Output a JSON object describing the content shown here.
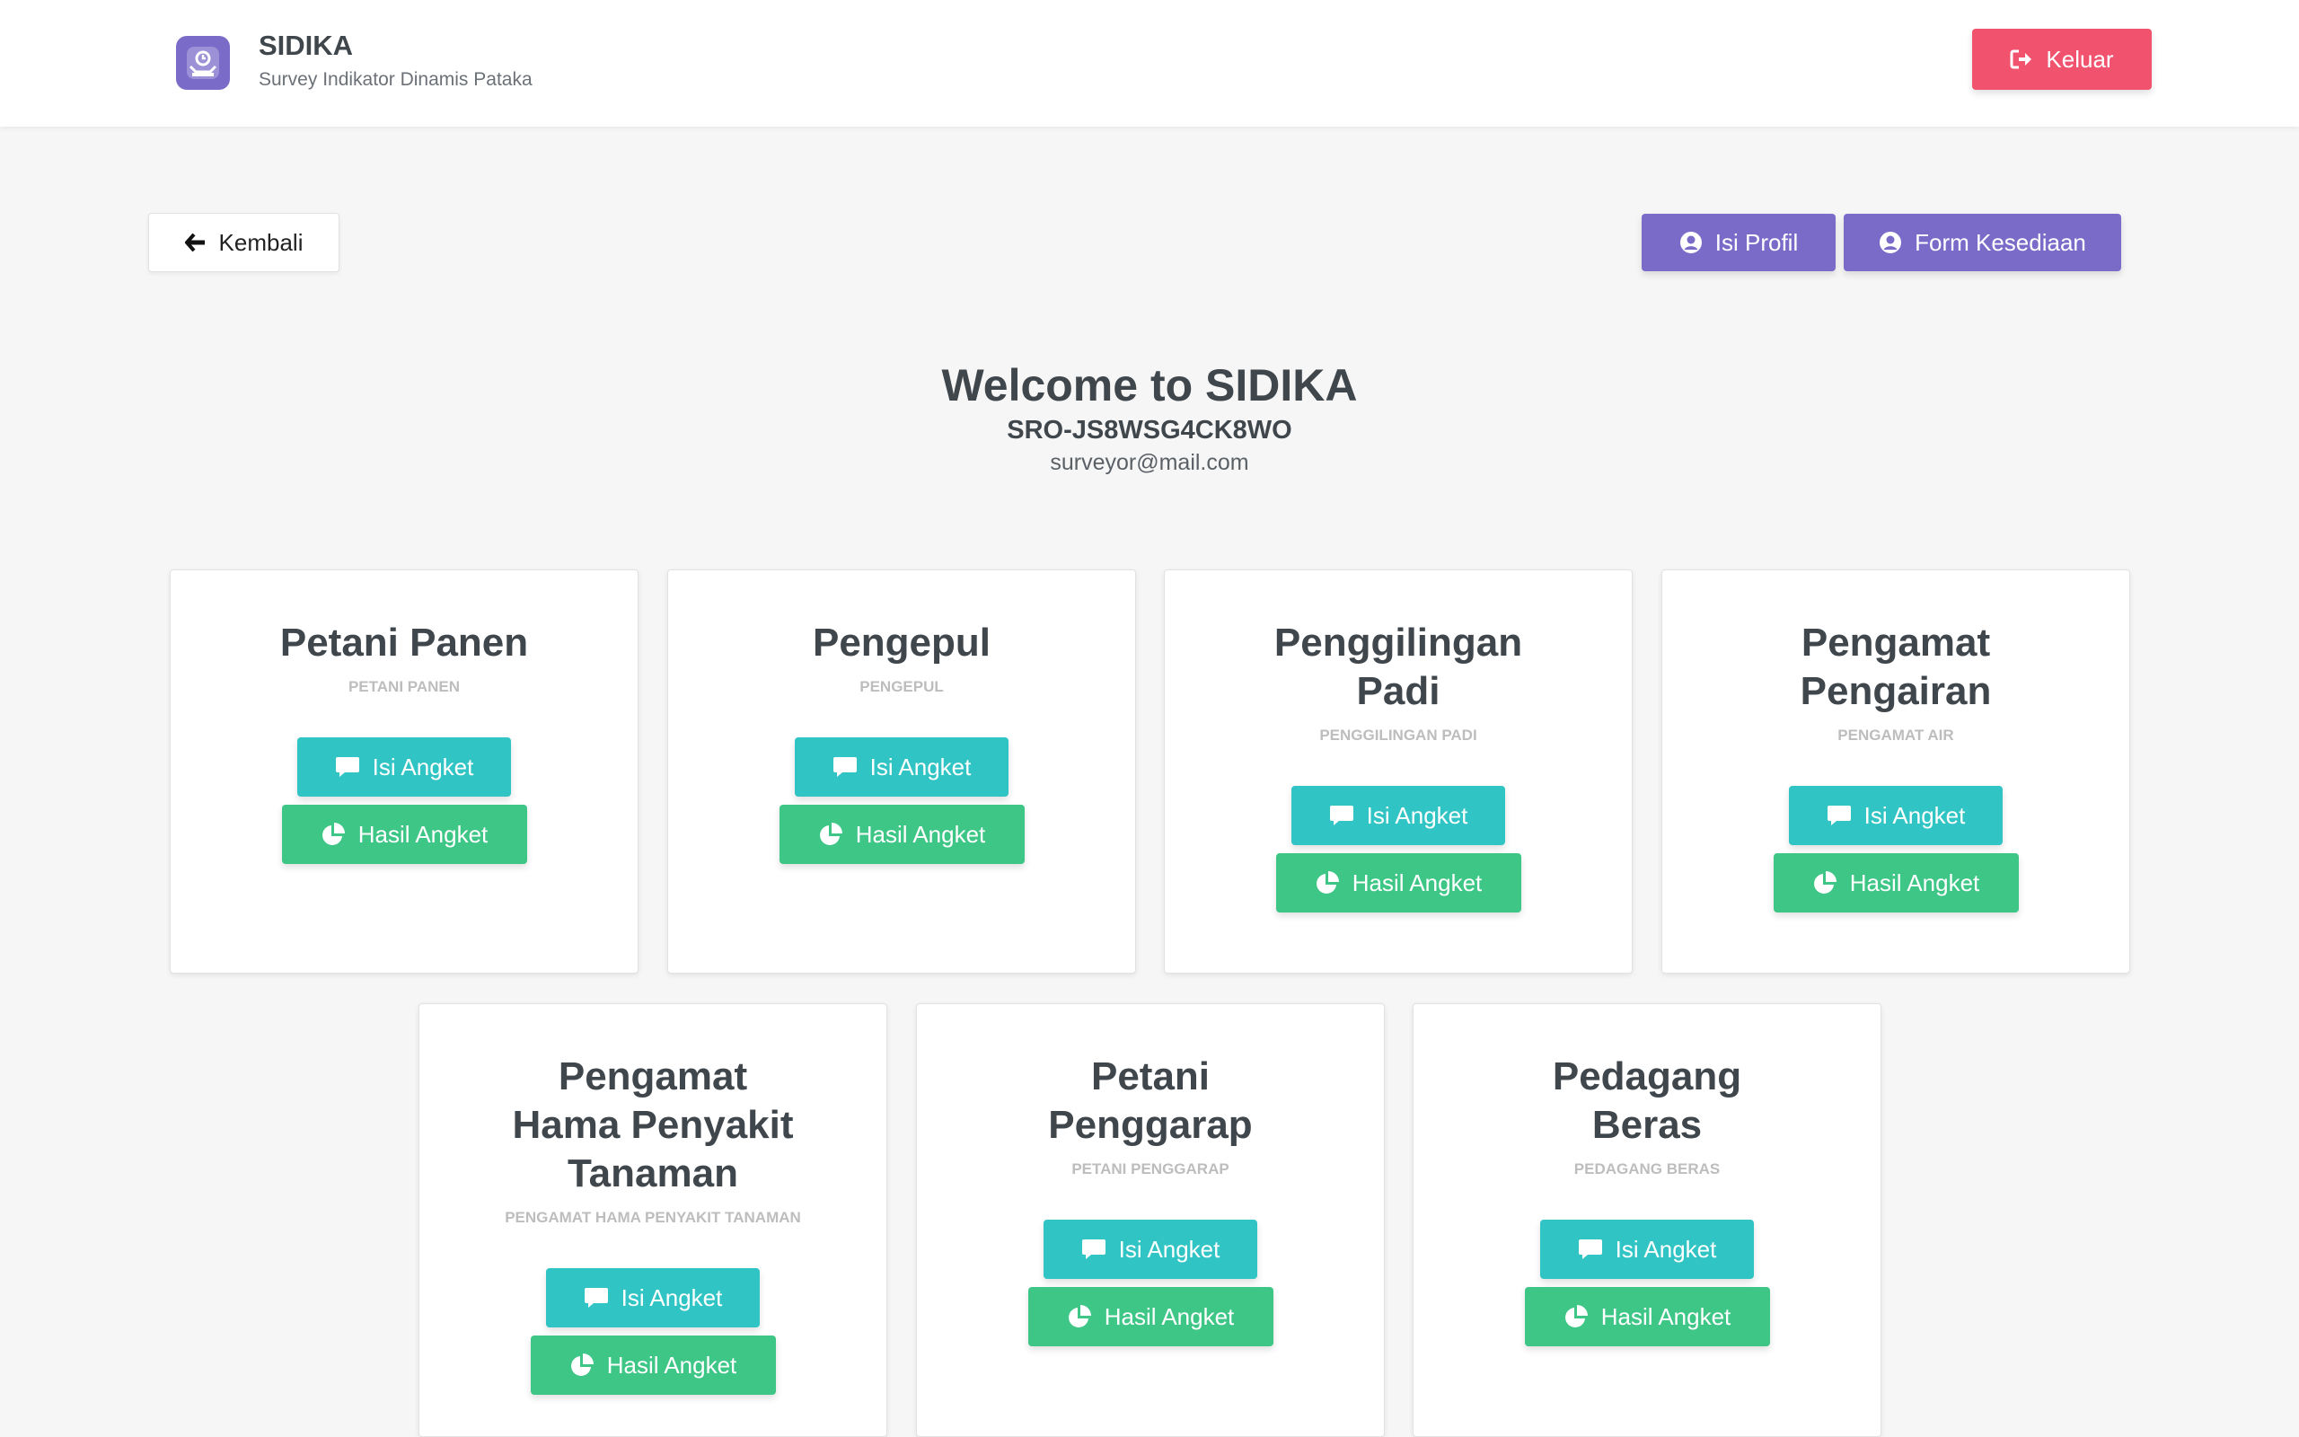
{
  "header": {
    "app_title": "SIDIKA",
    "app_subtitle": "Survey Indikator Dinamis Pataka",
    "logout_label": "Keluar"
  },
  "toolbar": {
    "back_label": "Kembali",
    "profile_label": "Isi Profil",
    "kesediaan_label": "Form Kesediaan"
  },
  "welcome": {
    "title": "Welcome to SIDIKA",
    "code": "SRO-JS8WSG4CK8WO",
    "email": "surveyor@mail.com"
  },
  "cards": [
    {
      "title": "Petani Panen",
      "subtitle": "PETANI PANEN",
      "isi_label": "Isi Angket",
      "hasil_label": "Hasil Angket"
    },
    {
      "title": "Pengepul",
      "subtitle": "PENGEPUL",
      "isi_label": "Isi Angket",
      "hasil_label": "Hasil Angket"
    },
    {
      "title": "Penggilingan Padi",
      "subtitle": "PENGGILINGAN PADI",
      "isi_label": "Isi Angket",
      "hasil_label": "Hasil Angket"
    },
    {
      "title": "Pengamat Pengairan",
      "subtitle": "PENGAMAT AIR",
      "isi_label": "Isi Angket",
      "hasil_label": "Hasil Angket"
    },
    {
      "title": "Pengamat Hama Penyakit Tanaman",
      "subtitle": "PENGAMAT HAMA PENYAKIT TANAMAN",
      "isi_label": "Isi Angket",
      "hasil_label": "Hasil Angket"
    },
    {
      "title": "Petani Penggarap",
      "subtitle": "PETANI PENGGARAP",
      "isi_label": "Isi Angket",
      "hasil_label": "Hasil Angket"
    },
    {
      "title": "Pedagang Beras",
      "subtitle": "PEDAGANG BERAS",
      "isi_label": "Isi Angket",
      "hasil_label": "Hasil Angket"
    }
  ],
  "icons": {
    "logo": "survey-logo-icon",
    "logout": "sign-out-icon",
    "back": "arrow-left-icon",
    "profile": "user-circle-icon",
    "isi": "comment-icon",
    "hasil": "pie-chart-icon"
  },
  "colors": {
    "logout": "#f1536e",
    "purple": "#7b6bc9",
    "isi": "#31c4c4",
    "hasil": "#3dc686"
  }
}
